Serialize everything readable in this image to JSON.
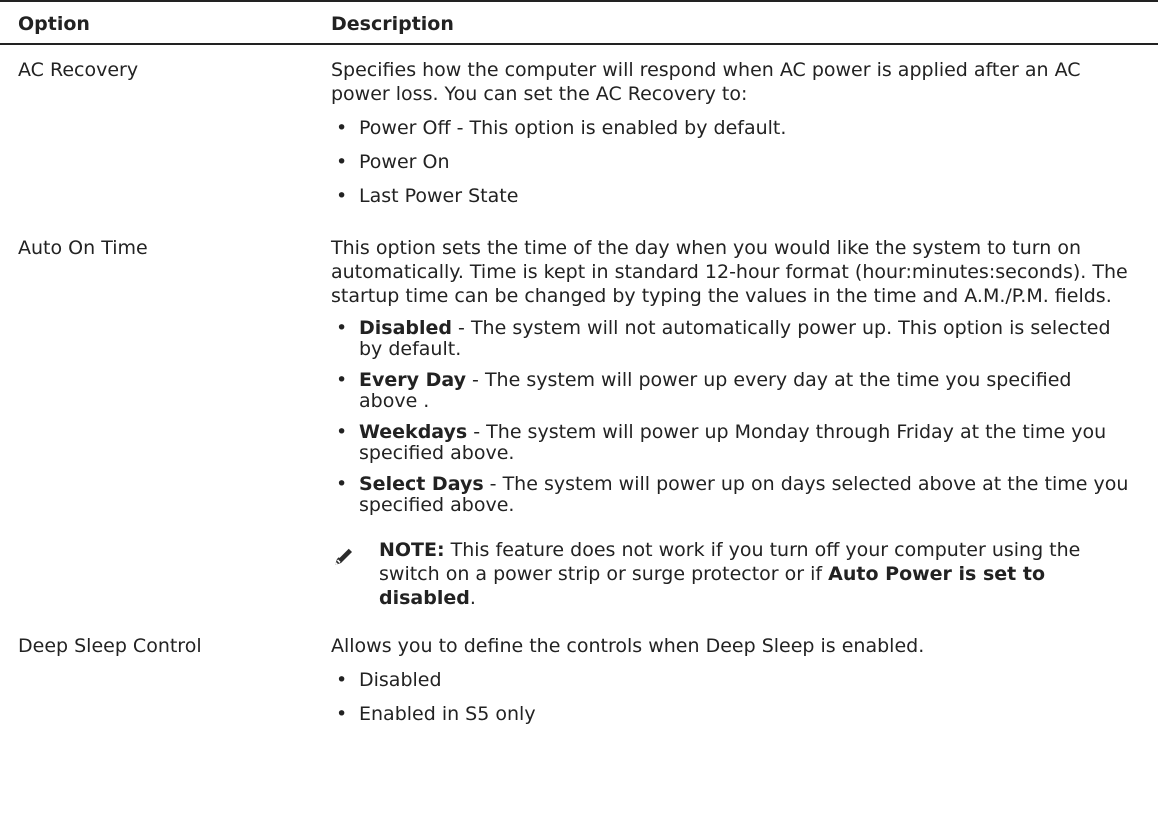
{
  "header": {
    "option": "Option",
    "description": "Description"
  },
  "rows": [
    {
      "option": "AC Recovery",
      "intro": "Specifies how the computer will respond when AC power is applied after an AC power loss. You can set the AC Recovery to:",
      "bullets": [
        "Power Off - This option is enabled by default.",
        "Power On",
        "Last Power State"
      ]
    },
    {
      "option": "Auto On Time",
      "intro": "This option sets the time of the day when you would like the system to turn on automatically. Time is kept in standard 12-hour format (hour:minutes:seconds). The startup time can be changed by typing the values in the time and A.M./P.M. fields.",
      "bullets": [
        {
          "term": "Disabled",
          "text": " - The system will not automatically power up. This option is selected by default."
        },
        {
          "term": "Every Day",
          "text": " - The system will power up every day at the time you specified above ."
        },
        {
          "term": "Weekdays",
          "text": " - The system will power up Monday through Friday at the time you specified above."
        },
        {
          "term": "Select Days",
          "text": " - The system will power up on days selected above at the time you specified above."
        }
      ],
      "note": {
        "label": "NOTE:",
        "text": " This feature does not work if you turn off your computer using the switch on a power strip or surge protector or if ",
        "bold_tail": "Auto Power is set to disabled",
        "end": "."
      }
    },
    {
      "option": "Deep Sleep Control",
      "intro": "Allows you to define the controls when Deep Sleep is enabled.",
      "bullets": [
        "Disabled",
        "Enabled in S5 only"
      ]
    }
  ],
  "bullet_glyph": "•",
  "icons": {
    "note": "pencil-note-icon"
  }
}
